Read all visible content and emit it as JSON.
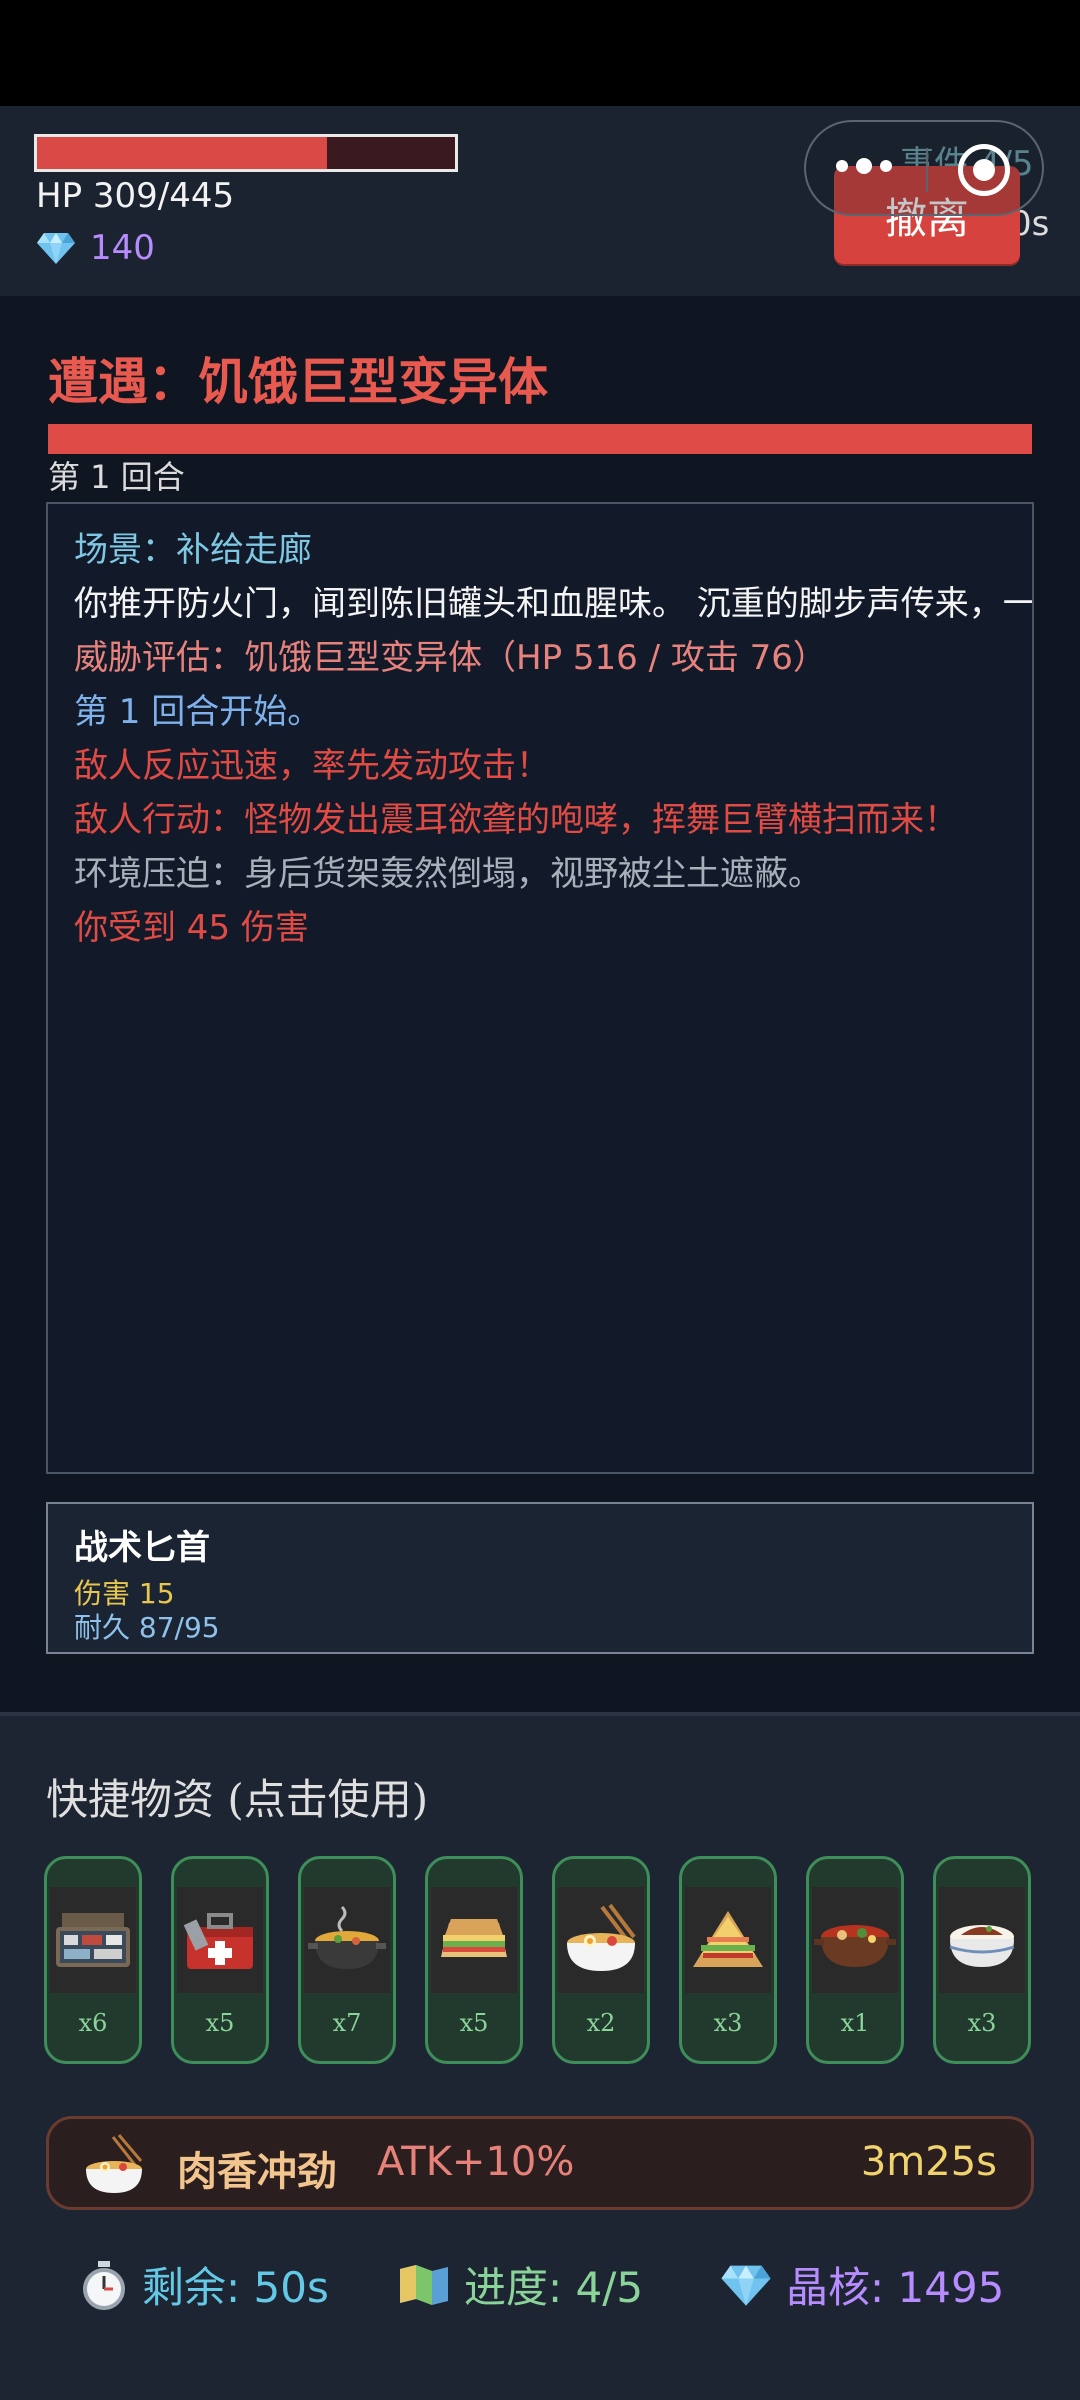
{
  "player": {
    "hp_text": "HP 309/445",
    "hp_current": 309,
    "hp_max": 445,
    "crystals": "140"
  },
  "header": {
    "events_text": "事件 4/5",
    "timer_text": "0s",
    "retreat_label": "撤离"
  },
  "encounter": {
    "title": "遭遇：饥饿巨型变异体",
    "enemy_hp_fraction": 1.0,
    "round": "第 1 回合"
  },
  "log": [
    {
      "text": "场景：补给走廊",
      "color": "cyan"
    },
    {
      "text": "你推开防火门，闻到陈旧罐头和血腥味。 沉重的脚步声传来，一",
      "color": "white"
    },
    {
      "text": "威胁评估：饥饿巨型变异体（HP 516 / 攻击 76）",
      "color": "pink"
    },
    {
      "text": "第 1 回合开始。",
      "color": "blue"
    },
    {
      "text": "敌人反应迅速，率先发动攻击！",
      "color": "red"
    },
    {
      "text": "敌人行动：怪物发出震耳欲聋的咆哮，挥舞巨臂横扫而来！",
      "color": "red"
    },
    {
      "text": "环境压迫：身后货架轰然倒塌，视野被尘土遮蔽。",
      "color": "grey"
    },
    {
      "text": "你受到 45 伤害",
      "color": "red"
    }
  ],
  "weapon": {
    "name": "战术匕首",
    "damage": "伤害 15",
    "durability": "耐久 87/95"
  },
  "quick": {
    "title": "快捷物资 (点击使用)",
    "items": [
      {
        "icon": "medical-kit-icon",
        "count": "x6"
      },
      {
        "icon": "first-aid-toolbox-icon",
        "count": "x5"
      },
      {
        "icon": "soup-pot-icon",
        "count": "x7"
      },
      {
        "icon": "sandwich-icon",
        "count": "x5"
      },
      {
        "icon": "noodle-bowl-icon",
        "count": "x2"
      },
      {
        "icon": "club-sandwich-icon",
        "count": "x3"
      },
      {
        "icon": "hotpot-icon",
        "count": "x1"
      },
      {
        "icon": "rice-bowl-icon",
        "count": "x3"
      }
    ]
  },
  "buff": {
    "icon": "noodle-bowl-icon",
    "name": "肉香冲劲",
    "effect": "ATK+10%",
    "time": "3m25s"
  },
  "stats": {
    "remaining": "剩余: 50s",
    "progress": "进度: 4/5",
    "crystals": "晶核: 1495"
  },
  "colors": {
    "accent_red": "#df4c47",
    "crystal_purple": "#b68cff",
    "success_green": "#8ad49a",
    "timer_yellow": "#f0d36e"
  }
}
